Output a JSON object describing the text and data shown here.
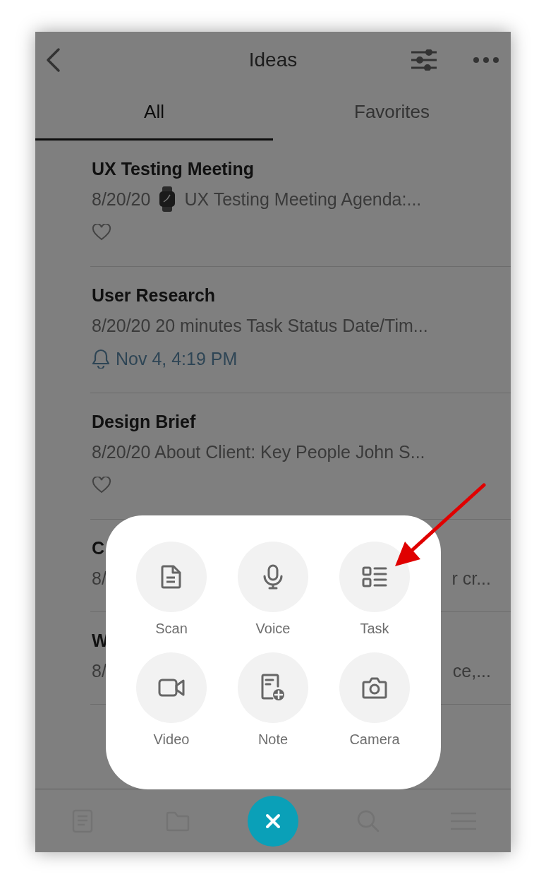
{
  "header": {
    "title": "Ideas"
  },
  "tabs": [
    {
      "label": "All",
      "selected": true
    },
    {
      "label": "Favorites",
      "selected": false
    }
  ],
  "notes": [
    {
      "title": "UX Testing Meeting",
      "date": "8/20/20",
      "watch": true,
      "snippet": "UX Testing Meeting Agenda:...",
      "kind": "heart",
      "favorite": false
    },
    {
      "title": "User Research",
      "snippet": "8/20/20 20 minutes Task Status Date/Tim...",
      "kind": "reminder",
      "reminder": "Nov 4, 4:19 PM"
    },
    {
      "title": "Design Brief",
      "snippet": "8/20/20 About Client:   Key People John S...",
      "kind": "heart",
      "favorite": false
    },
    {
      "title": "C",
      "snippet": "8/",
      "snippet_end": "r cr...",
      "kind": "plain"
    },
    {
      "title": "W",
      "snippet": "8/",
      "snippet_end": "ce,...",
      "kind": "plain"
    }
  ],
  "actions": [
    {
      "label": "Scan",
      "kind": "scan"
    },
    {
      "label": "Voice",
      "kind": "voice"
    },
    {
      "label": "Task",
      "kind": "task"
    },
    {
      "label": "Video",
      "kind": "video"
    },
    {
      "label": "Note",
      "kind": "note"
    },
    {
      "label": "Camera",
      "kind": "camera"
    }
  ],
  "bottom_bar": [
    {
      "kind": "notes"
    },
    {
      "kind": "folder"
    },
    {
      "kind": "close"
    },
    {
      "kind": "search"
    },
    {
      "kind": "menu"
    }
  ],
  "annotation": {
    "kind": "arrow"
  }
}
